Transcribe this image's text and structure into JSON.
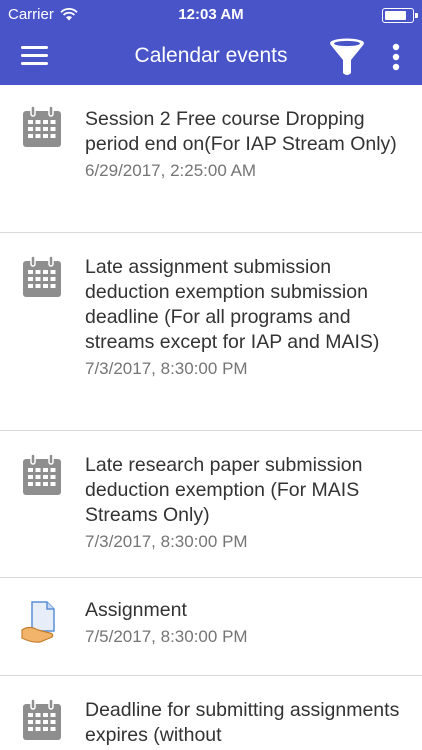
{
  "status_bar": {
    "carrier": "Carrier",
    "time": "12:03 AM",
    "battery_level": 0.8
  },
  "header": {
    "title": "Calendar events"
  },
  "colors": {
    "accent": "#4a54c9",
    "divider": "#d9d9d9",
    "icon_gray": "#8e8e8e"
  },
  "events": [
    {
      "icon": "calendar-icon",
      "name": "Session 2 Free course Dropping period end on(For IAP Stream Only)",
      "date": "6/29/2017, 2:25:00 AM"
    },
    {
      "icon": "calendar-icon",
      "name": "Late assignment submission deduction exemption submission deadline (For all programs and streams except for IAP and MAIS)",
      "date": "7/3/2017, 8:30:00 PM"
    },
    {
      "icon": "calendar-icon",
      "name": "Late research paper submission deduction exemption (For MAIS Streams Only)",
      "date": "7/3/2017, 8:30:00 PM"
    },
    {
      "icon": "assignment-icon",
      "name": "Assignment",
      "date": "7/5/2017, 8:30:00 PM"
    },
    {
      "icon": "calendar-icon",
      "name": "Deadline for submitting assignments expires (without",
      "date": ""
    }
  ]
}
